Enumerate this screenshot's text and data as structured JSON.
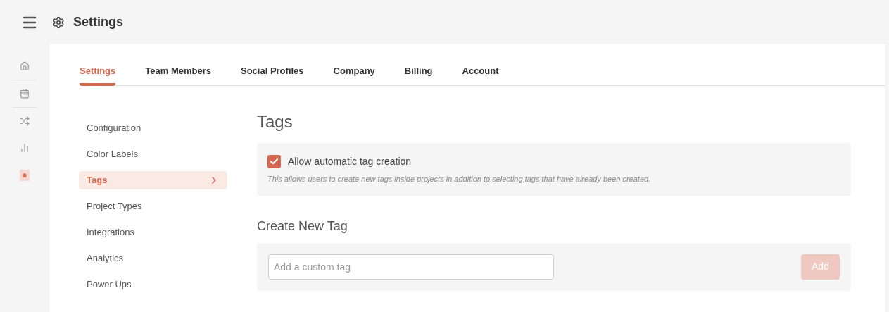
{
  "header": {
    "title": "Settings"
  },
  "rail": [
    {
      "kind": "home",
      "selected": false
    },
    {
      "kind": "calendar",
      "selected": false
    },
    {
      "kind": "shuffle",
      "selected": false
    },
    {
      "kind": "chart",
      "selected": false
    },
    {
      "kind": "star",
      "selected": true
    }
  ],
  "tabs": [
    {
      "label": "Settings",
      "selected": true
    },
    {
      "label": "Team Members",
      "selected": false
    },
    {
      "label": "Social Profiles",
      "selected": false
    },
    {
      "label": "Company",
      "selected": false
    },
    {
      "label": "Billing",
      "selected": false
    },
    {
      "label": "Account",
      "selected": false
    }
  ],
  "subnav": [
    {
      "label": "Configuration",
      "selected": false
    },
    {
      "label": "Color Labels",
      "selected": false
    },
    {
      "label": "Tags",
      "selected": true
    },
    {
      "label": "Project Types",
      "selected": false
    },
    {
      "label": "Integrations",
      "selected": false
    },
    {
      "label": "Analytics",
      "selected": false
    },
    {
      "label": "Power Ups",
      "selected": false
    }
  ],
  "page_title": "Tags",
  "option": {
    "label": "Allow automatic tag creation",
    "checked": true,
    "description": "This allows users to create new tags inside projects in addition to selecting tags that have already been created."
  },
  "create": {
    "title": "Create New Tag",
    "placeholder": "Add a custom tag",
    "button": "Add",
    "button_disabled": true
  }
}
